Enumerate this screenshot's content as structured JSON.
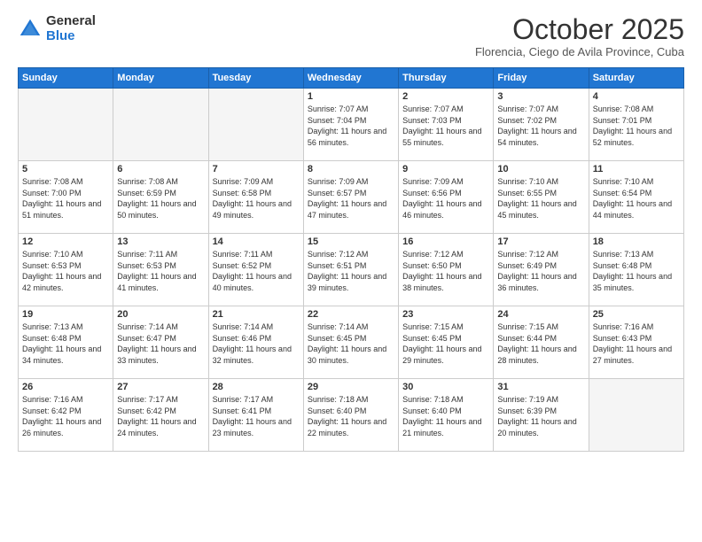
{
  "logo": {
    "general": "General",
    "blue": "Blue"
  },
  "title": "October 2025",
  "location": "Florencia, Ciego de Avila Province, Cuba",
  "days_of_week": [
    "Sunday",
    "Monday",
    "Tuesday",
    "Wednesday",
    "Thursday",
    "Friday",
    "Saturday"
  ],
  "weeks": [
    [
      {
        "day": "",
        "empty": true
      },
      {
        "day": "",
        "empty": true
      },
      {
        "day": "",
        "empty": true
      },
      {
        "day": "1",
        "sunrise": "7:07 AM",
        "sunset": "7:04 PM",
        "daylight": "11 hours and 56 minutes."
      },
      {
        "day": "2",
        "sunrise": "7:07 AM",
        "sunset": "7:03 PM",
        "daylight": "11 hours and 55 minutes."
      },
      {
        "day": "3",
        "sunrise": "7:07 AM",
        "sunset": "7:02 PM",
        "daylight": "11 hours and 54 minutes."
      },
      {
        "day": "4",
        "sunrise": "7:08 AM",
        "sunset": "7:01 PM",
        "daylight": "11 hours and 52 minutes."
      }
    ],
    [
      {
        "day": "5",
        "sunrise": "7:08 AM",
        "sunset": "7:00 PM",
        "daylight": "11 hours and 51 minutes."
      },
      {
        "day": "6",
        "sunrise": "7:08 AM",
        "sunset": "6:59 PM",
        "daylight": "11 hours and 50 minutes."
      },
      {
        "day": "7",
        "sunrise": "7:09 AM",
        "sunset": "6:58 PM",
        "daylight": "11 hours and 49 minutes."
      },
      {
        "day": "8",
        "sunrise": "7:09 AM",
        "sunset": "6:57 PM",
        "daylight": "11 hours and 47 minutes."
      },
      {
        "day": "9",
        "sunrise": "7:09 AM",
        "sunset": "6:56 PM",
        "daylight": "11 hours and 46 minutes."
      },
      {
        "day": "10",
        "sunrise": "7:10 AM",
        "sunset": "6:55 PM",
        "daylight": "11 hours and 45 minutes."
      },
      {
        "day": "11",
        "sunrise": "7:10 AM",
        "sunset": "6:54 PM",
        "daylight": "11 hours and 44 minutes."
      }
    ],
    [
      {
        "day": "12",
        "sunrise": "7:10 AM",
        "sunset": "6:53 PM",
        "daylight": "11 hours and 42 minutes."
      },
      {
        "day": "13",
        "sunrise": "7:11 AM",
        "sunset": "6:53 PM",
        "daylight": "11 hours and 41 minutes."
      },
      {
        "day": "14",
        "sunrise": "7:11 AM",
        "sunset": "6:52 PM",
        "daylight": "11 hours and 40 minutes."
      },
      {
        "day": "15",
        "sunrise": "7:12 AM",
        "sunset": "6:51 PM",
        "daylight": "11 hours and 39 minutes."
      },
      {
        "day": "16",
        "sunrise": "7:12 AM",
        "sunset": "6:50 PM",
        "daylight": "11 hours and 38 minutes."
      },
      {
        "day": "17",
        "sunrise": "7:12 AM",
        "sunset": "6:49 PM",
        "daylight": "11 hours and 36 minutes."
      },
      {
        "day": "18",
        "sunrise": "7:13 AM",
        "sunset": "6:48 PM",
        "daylight": "11 hours and 35 minutes."
      }
    ],
    [
      {
        "day": "19",
        "sunrise": "7:13 AM",
        "sunset": "6:48 PM",
        "daylight": "11 hours and 34 minutes."
      },
      {
        "day": "20",
        "sunrise": "7:14 AM",
        "sunset": "6:47 PM",
        "daylight": "11 hours and 33 minutes."
      },
      {
        "day": "21",
        "sunrise": "7:14 AM",
        "sunset": "6:46 PM",
        "daylight": "11 hours and 32 minutes."
      },
      {
        "day": "22",
        "sunrise": "7:14 AM",
        "sunset": "6:45 PM",
        "daylight": "11 hours and 30 minutes."
      },
      {
        "day": "23",
        "sunrise": "7:15 AM",
        "sunset": "6:45 PM",
        "daylight": "11 hours and 29 minutes."
      },
      {
        "day": "24",
        "sunrise": "7:15 AM",
        "sunset": "6:44 PM",
        "daylight": "11 hours and 28 minutes."
      },
      {
        "day": "25",
        "sunrise": "7:16 AM",
        "sunset": "6:43 PM",
        "daylight": "11 hours and 27 minutes."
      }
    ],
    [
      {
        "day": "26",
        "sunrise": "7:16 AM",
        "sunset": "6:42 PM",
        "daylight": "11 hours and 26 minutes."
      },
      {
        "day": "27",
        "sunrise": "7:17 AM",
        "sunset": "6:42 PM",
        "daylight": "11 hours and 24 minutes."
      },
      {
        "day": "28",
        "sunrise": "7:17 AM",
        "sunset": "6:41 PM",
        "daylight": "11 hours and 23 minutes."
      },
      {
        "day": "29",
        "sunrise": "7:18 AM",
        "sunset": "6:40 PM",
        "daylight": "11 hours and 22 minutes."
      },
      {
        "day": "30",
        "sunrise": "7:18 AM",
        "sunset": "6:40 PM",
        "daylight": "11 hours and 21 minutes."
      },
      {
        "day": "31",
        "sunrise": "7:19 AM",
        "sunset": "6:39 PM",
        "daylight": "11 hours and 20 minutes."
      },
      {
        "day": "",
        "empty": true
      }
    ]
  ]
}
